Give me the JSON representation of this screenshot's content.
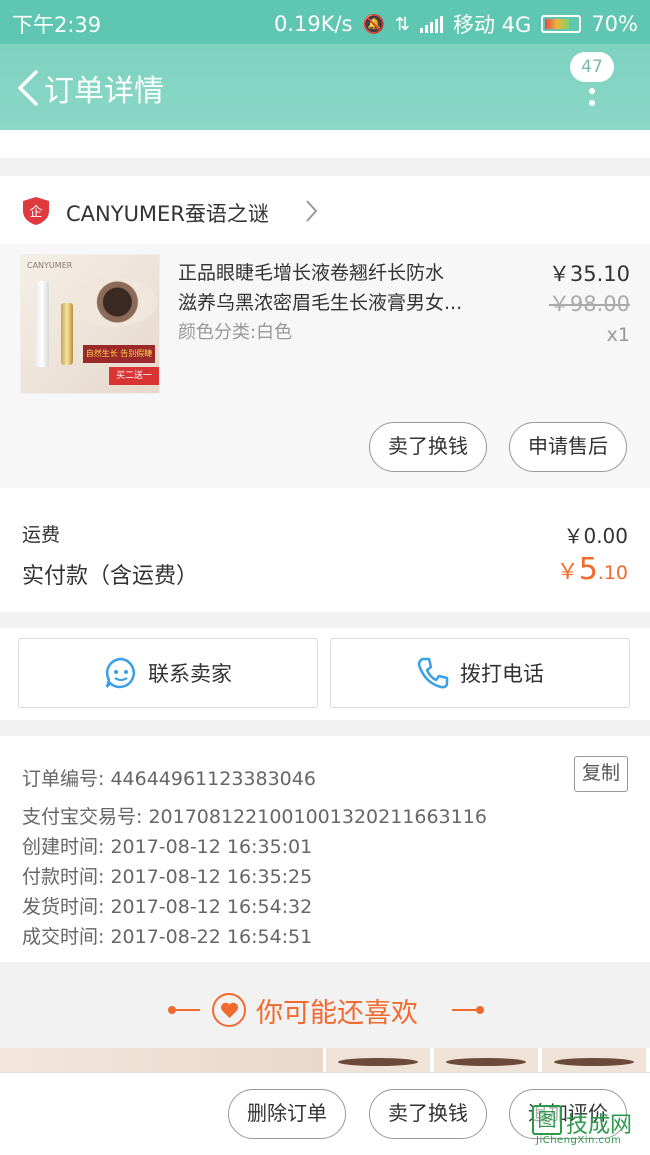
{
  "status_bar": {
    "time": "下午2:39",
    "network_speed": "0.19K/s",
    "carrier": "移动 4G",
    "battery": "70%"
  },
  "nav": {
    "title": "订单详情",
    "badge": "47"
  },
  "shop": {
    "name": "CANYUMER蚕语之谜",
    "logo_glyph": "企"
  },
  "goods": {
    "title_line1": "正品眼睫毛增长液卷翘纤长防水",
    "title_line2": "滋养乌黑浓密眉毛生长液膏男女...",
    "sku": "颜色分类:白色",
    "price": "￥35.10",
    "original_price": "￥98.00",
    "quantity": "x1",
    "image": {
      "brand": "CANYUMER",
      "promo": "自然生长 告别假睫毛",
      "sale": "买二送一"
    },
    "actions": [
      "卖了换钱",
      "申请售后"
    ]
  },
  "fees": {
    "shipping_label": "运费",
    "shipping_value": "￥0.00",
    "paid_label": "实付款（含运费）",
    "paid_currency": "￥",
    "paid_int": "5",
    "paid_dec": ".10"
  },
  "contact": {
    "seller": "联系卖家",
    "call": "拨打电话"
  },
  "order_info": {
    "order_no": "订单编号: 44644961123383046",
    "copy": "复制",
    "alipay_no": "支付宝交易号: 2017081221001001320211663116",
    "created": "创建时间: 2017-08-12 16:35:01",
    "paid": "付款时间: 2017-08-12 16:35:25",
    "shipped": "发货时间: 2017-08-12 16:54:32",
    "completed": "成交时间: 2017-08-22 16:54:51"
  },
  "recommend": {
    "title": "你可能还喜欢"
  },
  "bottom_actions": [
    "删除订单",
    "卖了换钱",
    "追加评价"
  ],
  "watermark": {
    "glyph": "图",
    "text": "技成网",
    "url": "JiChengXin.com"
  },
  "colors": {
    "header": "#7ed2c0",
    "statusbar": "#5fc7b1",
    "accent": "#f26a2e",
    "contact_icon": "#3aa0e6"
  }
}
